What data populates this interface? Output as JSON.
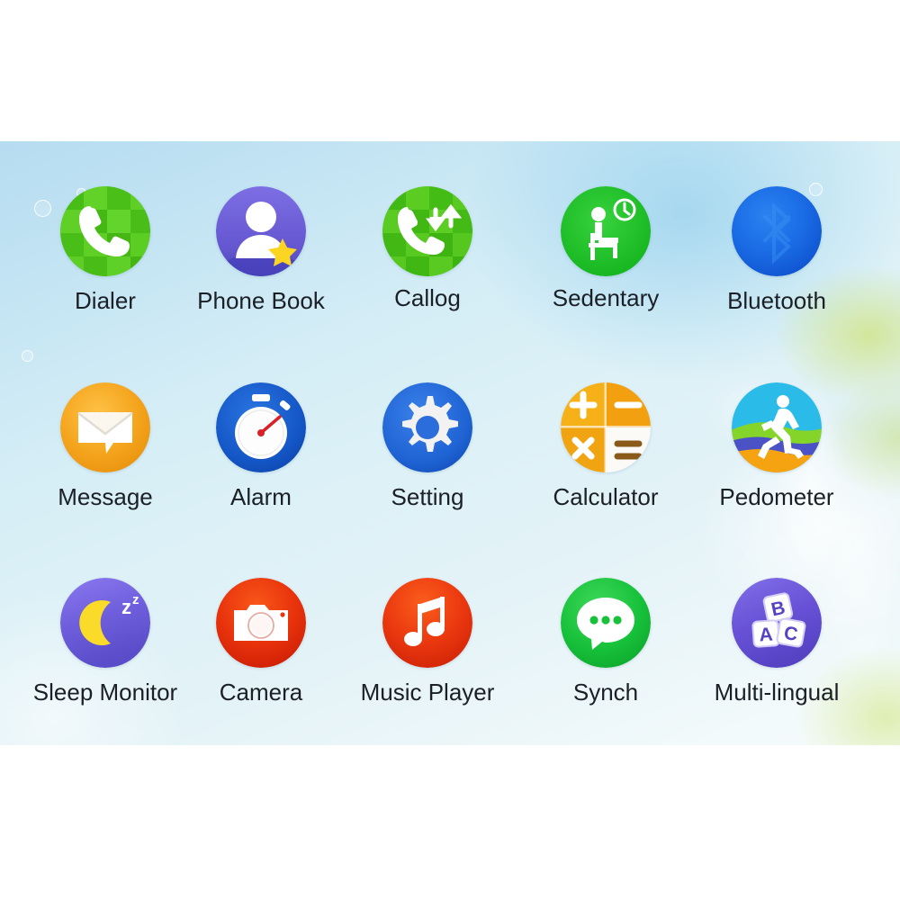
{
  "screen": {
    "kind": "smartwatch-app-launcher",
    "background_top_color": "#b6dcf1",
    "background_bottom_color": "#f6fbfc",
    "label_color": "#1b1f26"
  },
  "grid": {
    "rows": 3,
    "columns": 5,
    "apps": [
      {
        "id": "dialer",
        "label": "Dialer",
        "icon": "phone-handset-icon",
        "color": "#4cc417",
        "row": 1,
        "col": 1
      },
      {
        "id": "phone-book",
        "label": "Phone Book",
        "icon": "contact-person-star-icon",
        "color": "#6b5fd6",
        "row": 1,
        "col": 2
      },
      {
        "id": "callog",
        "label": "Callog",
        "icon": "call-log-arrows-icon",
        "color": "#3fbe13",
        "row": 1,
        "col": 3
      },
      {
        "id": "sedentary",
        "label": "Sedentary",
        "icon": "seated-person-clock-icon",
        "color": "#22c12a",
        "row": 1,
        "col": 4
      },
      {
        "id": "bluetooth",
        "label": "Bluetooth",
        "icon": "bluetooth-icon",
        "color": "#1667e0",
        "row": 1,
        "col": 5
      },
      {
        "id": "message",
        "label": "Message",
        "icon": "envelope-bubble-icon",
        "color": "#f0a020",
        "row": 2,
        "col": 1
      },
      {
        "id": "alarm",
        "label": "Alarm",
        "icon": "stopwatch-icon",
        "color": "#1a5fd0",
        "row": 2,
        "col": 2
      },
      {
        "id": "setting",
        "label": "Setting",
        "icon": "gear-icon",
        "color": "#2a6ddb",
        "row": 2,
        "col": 3
      },
      {
        "id": "calculator",
        "label": "Calculator",
        "icon": "calculator-icon",
        "color": "#f5a81c",
        "row": 2,
        "col": 4
      },
      {
        "id": "pedometer",
        "label": "Pedometer",
        "icon": "running-person-icon",
        "color": "#2bb8e8",
        "row": 2,
        "col": 5
      },
      {
        "id": "sleep-monitor",
        "label": "Sleep Monitor",
        "icon": "moon-zzz-icon",
        "color": "#6f5fd8",
        "row": 3,
        "col": 1
      },
      {
        "id": "camera",
        "label": "Camera",
        "icon": "camera-icon",
        "color": "#e8340c",
        "row": 3,
        "col": 2
      },
      {
        "id": "music-player",
        "label": "Music Player",
        "icon": "music-note-icon",
        "color": "#ec3c10",
        "row": 3,
        "col": 3
      },
      {
        "id": "synch",
        "label": "Synch",
        "icon": "chat-bubble-dots-icon",
        "color": "#22c247",
        "row": 3,
        "col": 4
      },
      {
        "id": "multi-lingual",
        "label": "Multi-lingual",
        "icon": "abc-blocks-icon",
        "color": "#6a52d4",
        "row": 3,
        "col": 5
      }
    ]
  }
}
